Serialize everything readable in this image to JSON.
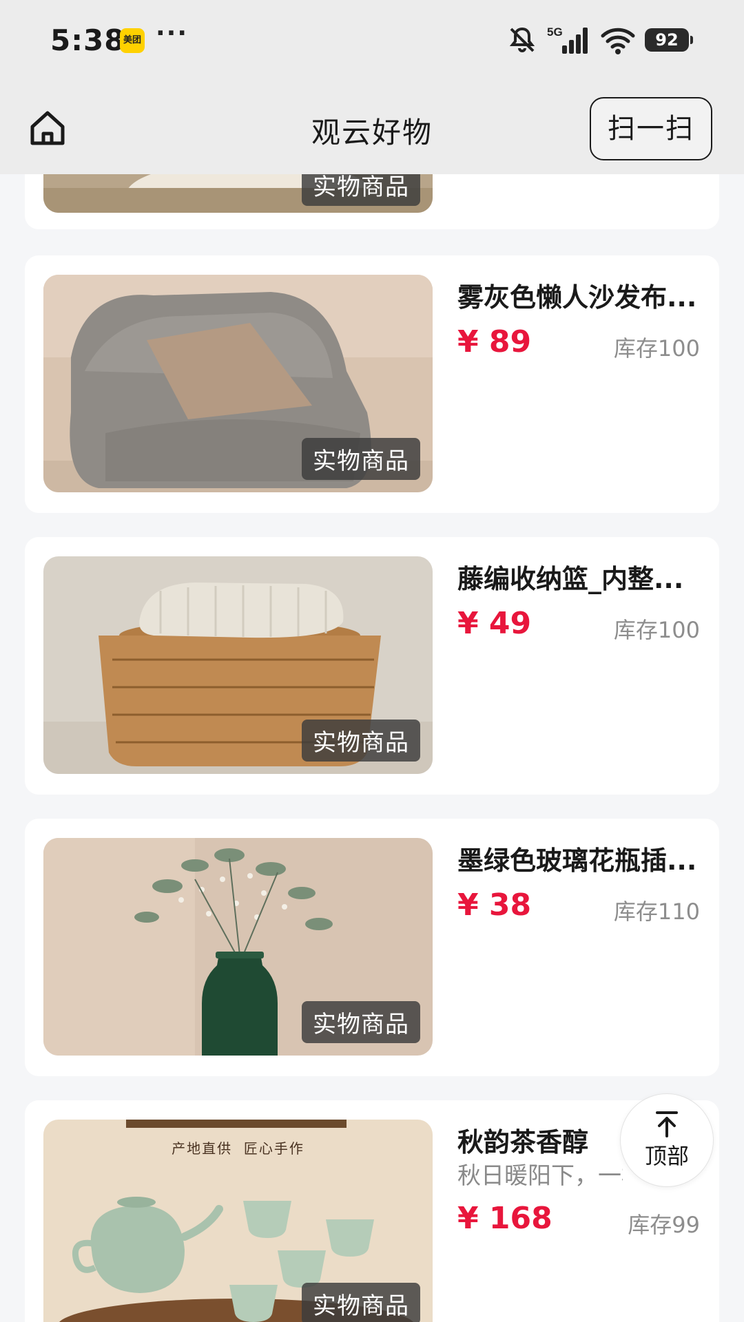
{
  "status_bar": {
    "time": "5:38",
    "app_badge": "美团",
    "more": "···",
    "network": "5G",
    "battery": "92"
  },
  "nav": {
    "title": "观云好物",
    "scan_label": "扫一扫",
    "home_icon": "home-icon"
  },
  "products": [
    {
      "name": "雾灰色懒人沙发布...",
      "price": "¥ 89",
      "stock": "库存100",
      "tag": "实物商品"
    },
    {
      "name": "藤编收纳篮_内整...",
      "price": "¥ 49",
      "stock": "库存100",
      "tag": "实物商品"
    },
    {
      "name": "墨绿色玻璃花瓶插...",
      "price": "¥ 38",
      "stock": "库存110",
      "tag": "实物商品"
    },
    {
      "name": "秋韵茶香醇",
      "subtitle": "秋日暖阳下，一杯",
      "price": "¥ 168",
      "stock": "库存99",
      "tag": "实物商品",
      "image_caption": "产地直供  匠心手作"
    }
  ],
  "partial_card": {
    "tag": "实物商品"
  },
  "top_button": {
    "label": "顶部",
    "icon": "arrow-up-icon"
  }
}
